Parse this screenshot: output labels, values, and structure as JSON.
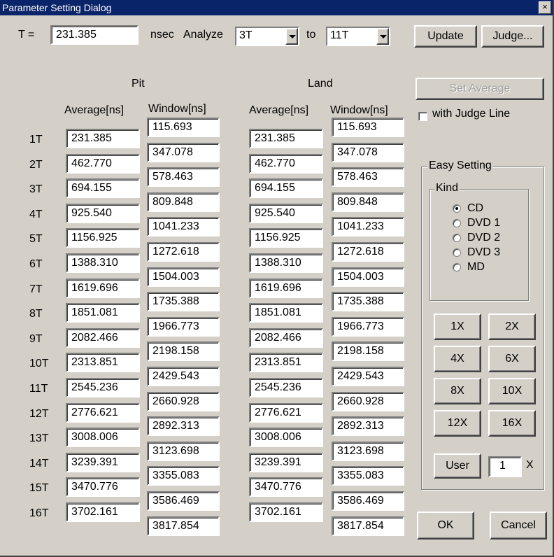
{
  "window": {
    "title": "Parameter Setting Dialog",
    "close": "×"
  },
  "top": {
    "t_label": "T =",
    "t_value": "231.385",
    "unit": "nsec",
    "analyze_label": "Analyze",
    "from_value": "3T",
    "to_label": "to",
    "to_value": "11T",
    "update": "Update",
    "judge": "Judge..."
  },
  "headers": {
    "pit": "Pit",
    "land": "Land",
    "average": "Average[ns]",
    "window": "Window[ns]"
  },
  "rows": [
    "1T",
    "2T",
    "3T",
    "4T",
    "5T",
    "6T",
    "7T",
    "8T",
    "9T",
    "10T",
    "11T",
    "12T",
    "13T",
    "14T",
    "15T",
    "16T"
  ],
  "pit_average": [
    "231.385",
    "462.770",
    "694.155",
    "925.540",
    "1156.925",
    "1388.310",
    "1619.696",
    "1851.081",
    "2082.466",
    "2313.851",
    "2545.236",
    "2776.621",
    "3008.006",
    "3239.391",
    "3470.776",
    "3702.161"
  ],
  "pit_window": [
    "115.693",
    "347.078",
    "578.463",
    "809.848",
    "1041.233",
    "1272.618",
    "1504.003",
    "1735.388",
    "1966.773",
    "2198.158",
    "2429.543",
    "2660.928",
    "2892.313",
    "3123.698",
    "3355.083",
    "3586.469",
    "3817.854"
  ],
  "land_average": [
    "231.385",
    "462.770",
    "694.155",
    "925.540",
    "1156.925",
    "1388.310",
    "1619.696",
    "1851.081",
    "2082.466",
    "2313.851",
    "2545.236",
    "2776.621",
    "3008.006",
    "3239.391",
    "3470.776",
    "3702.161"
  ],
  "land_window": [
    "115.693",
    "347.078",
    "578.463",
    "809.848",
    "1041.233",
    "1272.618",
    "1504.003",
    "1735.388",
    "1966.773",
    "2198.158",
    "2429.543",
    "2660.928",
    "2892.313",
    "3123.698",
    "3355.083",
    "3586.469",
    "3817.854"
  ],
  "right": {
    "set_average": "Set Average",
    "with_judge_line": "with Judge Line",
    "easy_setting": "Easy Setting",
    "kind": "Kind",
    "kinds": [
      "CD",
      "DVD 1",
      "DVD 2",
      "DVD 3",
      "MD"
    ],
    "selected_kind": "CD",
    "speeds": [
      "1X",
      "2X",
      "4X",
      "6X",
      "8X",
      "10X",
      "12X",
      "16X"
    ],
    "user": "User",
    "user_value": "1",
    "x_label": "X",
    "ok": "OK",
    "cancel": "Cancel"
  }
}
